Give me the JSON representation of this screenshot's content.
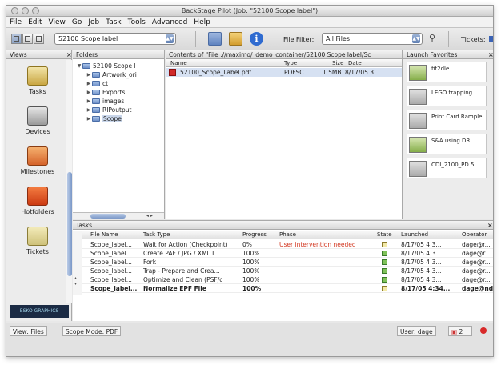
{
  "window": {
    "title": "BackStage Pilot (Job: \"52100 Scope label\")"
  },
  "menu": [
    "File",
    "Edit",
    "View",
    "Go",
    "Job",
    "Task",
    "Tools",
    "Advanced",
    "Help"
  ],
  "toolbar": {
    "job": "52100 Scope label",
    "file_filter_label": "File Filter:",
    "file_filter_value": "All Files",
    "tickets_label": "Tickets:"
  },
  "views": {
    "header": "Views",
    "items": [
      "Tasks",
      "Devices",
      "Milestones",
      "Hotfolders",
      "Tickets"
    ]
  },
  "folders": {
    "header": "Folders",
    "root": "52100 Scope l",
    "children": [
      "Artwork_ori",
      "ct",
      "Exports",
      "images",
      "RIPoutput",
      "Scope"
    ]
  },
  "contents": {
    "header": "Contents of \"File ://maximo/_demo_container/52100 Scope label/Sc",
    "columns": [
      "Name",
      "Type",
      "Size",
      "Date"
    ],
    "files": [
      {
        "name": "52100_Scope_Label.pdf",
        "type": "PDFSC",
        "size": "1.5MB",
        "date": "8/17/05 3..."
      }
    ]
  },
  "launch": {
    "header": "Launch Favorites",
    "items": [
      "fit2dle",
      "LEGO trapping",
      "Print Card Rample",
      "S&A using DR",
      "CDI_2100_PD 5"
    ]
  },
  "tasks": {
    "header": "Tasks",
    "columns": [
      "File Name",
      "Task Type",
      "Progress",
      "Phase",
      "State",
      "Launched",
      "Operator"
    ],
    "rows": [
      {
        "file": "Scope_label...",
        "type": "Wait for Action (Checkpoint)",
        "progress": "0%",
        "phase": "User intervention needed",
        "launched": "8/17/05 4:3...",
        "operator": "dage@r..."
      },
      {
        "file": "Scope_label...",
        "type": "Create PAF / JPG / XML I...",
        "progress": "100%",
        "phase": "",
        "launched": "8/17/05 4:3...",
        "operator": "dage@r..."
      },
      {
        "file": "Scope_label...",
        "type": "Fork",
        "progress": "100%",
        "phase": "",
        "launched": "8/17/05 4:3...",
        "operator": "dage@r..."
      },
      {
        "file": "Scope_label...",
        "type": "Trap - Prepare and Crea...",
        "progress": "100%",
        "phase": "",
        "launched": "8/17/05 4:3...",
        "operator": "dage@r..."
      },
      {
        "file": "Scope_label...",
        "type": "Optimize and Clean (PSF/c",
        "progress": "100%",
        "phase": "",
        "launched": "8/17/05 4:3...",
        "operator": "dage@r..."
      },
      {
        "file": "Scope_label...",
        "type": "Normalize EPF File",
        "progress": "100%",
        "phase": "",
        "launched": "8/17/05 4:34...",
        "operator": "dage@nd..."
      }
    ]
  },
  "status": {
    "view": "View: Files",
    "scope": "Scope Mode: PDF",
    "user": "User: dage",
    "count": "2"
  }
}
